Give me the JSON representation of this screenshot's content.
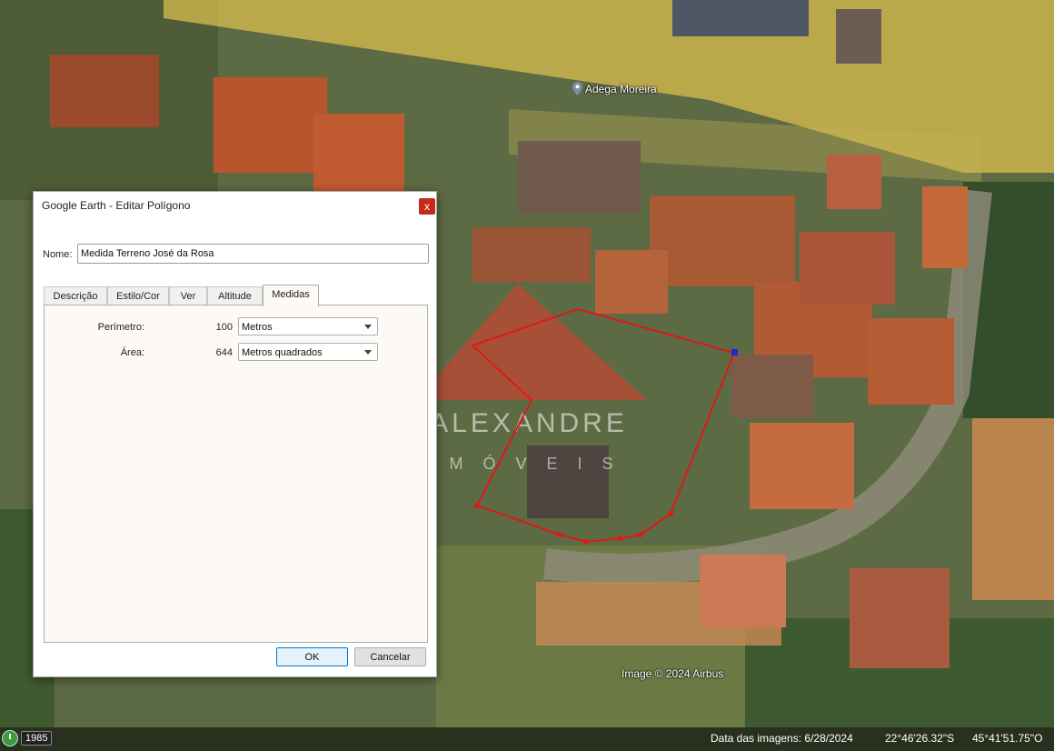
{
  "map": {
    "place_label": "Adega Moreira",
    "pin_icon": "map-pin-icon",
    "attribution": "Image © 2024 Airbus",
    "watermark": {
      "brand": "ALEXANDRE",
      "sub": "IMÓVEIS"
    }
  },
  "status": {
    "year": "1985",
    "image_date": "Data das imagens: 6/28/2024",
    "latitude": "22°46'26.32\"S",
    "longitude": "45°41'51.75\"O"
  },
  "dialog": {
    "title": "Google Earth - Editar Polígono",
    "close_label": "x",
    "name_label": "Nome:",
    "name_value": "Medida Terreno José da Rosa",
    "tabs": [
      {
        "label": "Descrição"
      },
      {
        "label": "Estilo/Cor"
      },
      {
        "label": "Ver"
      },
      {
        "label": "Altitude"
      },
      {
        "label": "Medidas"
      }
    ],
    "active_tab": "Medidas",
    "perimeter_label": "Perímetro:",
    "perimeter_value": "100",
    "perimeter_unit": "Metros",
    "area_label": "Área:",
    "area_value": "644",
    "area_unit": "Metros quadrados",
    "ok_label": "OK",
    "cancel_label": "Cancelar"
  },
  "colors": {
    "polygon": "#e01818",
    "road_highlight": "#e8c84a",
    "close_button": "#c42b1c"
  }
}
